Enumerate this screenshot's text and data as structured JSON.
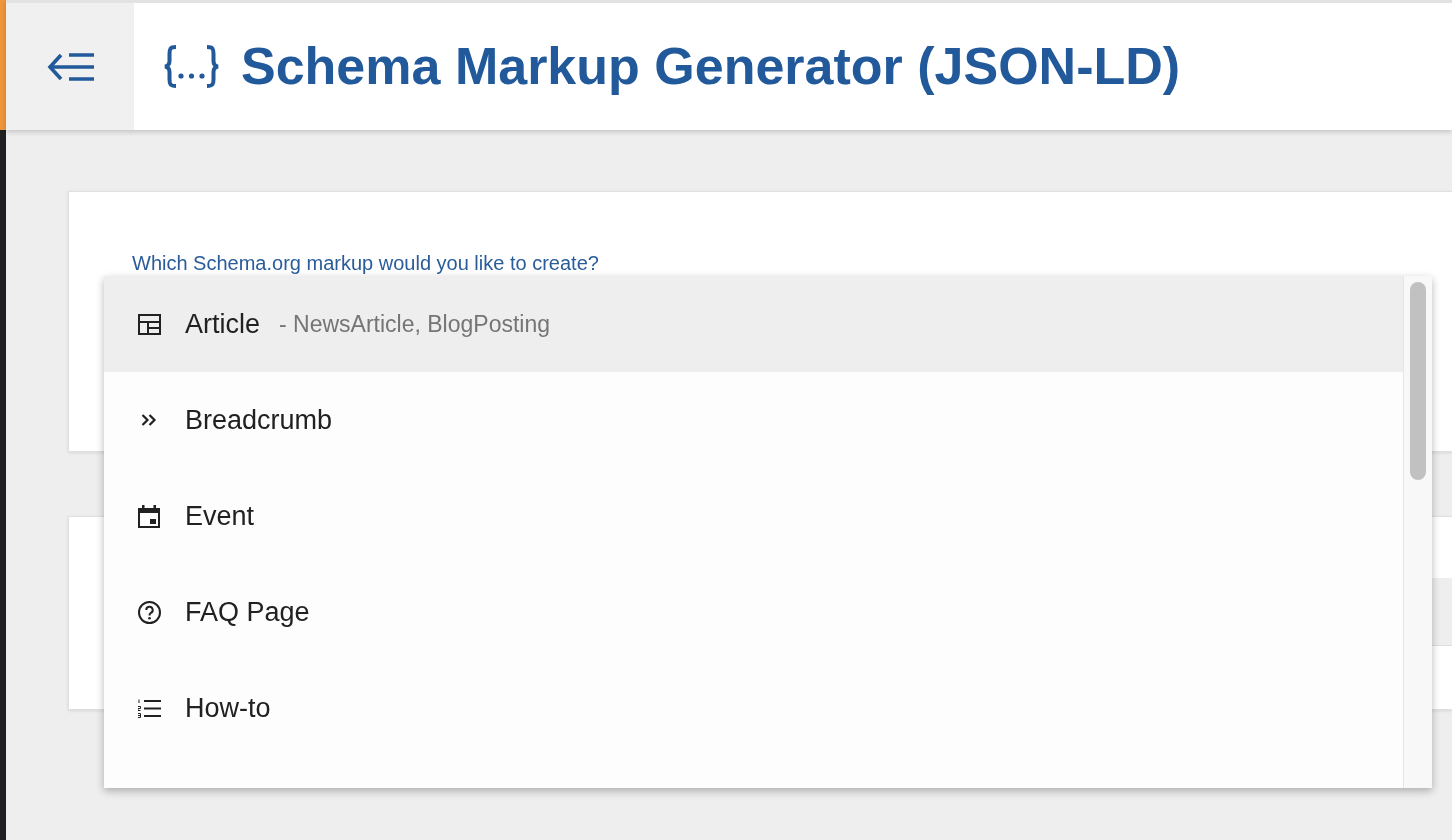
{
  "header": {
    "title": "Schema Markup Generator (JSON-LD)"
  },
  "schema_form": {
    "question": "Which Schema.org markup would you like to create?"
  },
  "schema_dropdown": {
    "options": [
      {
        "kind": "article",
        "label": "Article",
        "detail": "- NewsArticle, BlogPosting",
        "selected": true
      },
      {
        "kind": "breadcrumb",
        "label": "Breadcrumb",
        "selected": false
      },
      {
        "kind": "event",
        "label": "Event",
        "selected": false
      },
      {
        "kind": "faq",
        "label": "FAQ Page",
        "selected": false
      },
      {
        "kind": "howto",
        "label": "How-to",
        "selected": false
      }
    ]
  }
}
